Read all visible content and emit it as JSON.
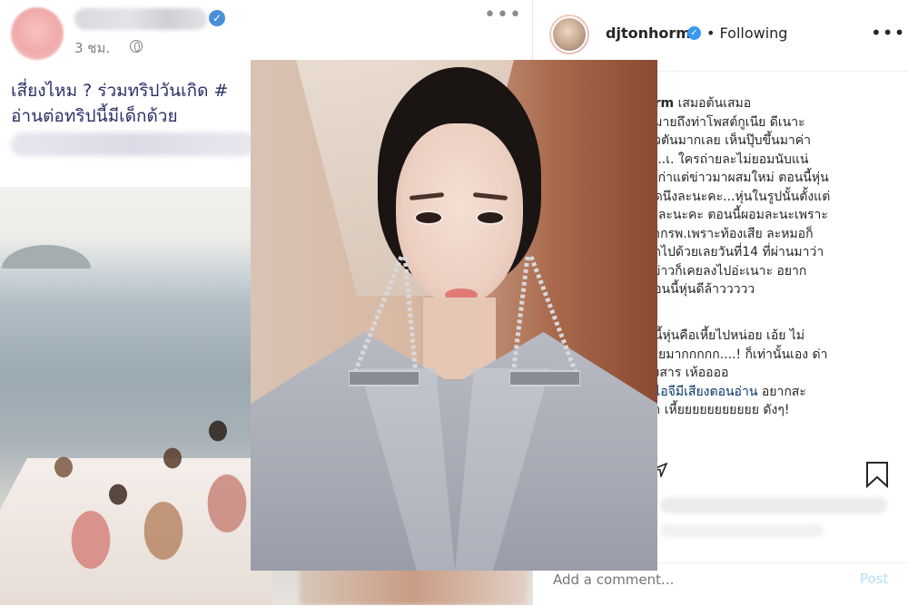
{
  "facebook_post": {
    "time": "3 ชม.",
    "text_line1": "เสี่ยงไหม ? ร่วมทริปวันเกิด #",
    "text_line2": "อ่านต่อทริปนี้มีเด็กด้วย"
  },
  "instagram_post": {
    "username": "djtonhorm",
    "following_label": "• Following",
    "caption_username": "orm",
    "caption_lines": "เสมอต้นเสมอ\nหมายถึงท่าโพสต์กูเนีย ดีเนาะ\nตัวตันมากเลย เห็นปุ๊บขึ้นมาค่า\n.....เ. ใครถ่ายละไม่ยอมนับแน่\nปเก่าแต่ข่าวมาผสมใหม่ ตอนนี้หุ่น\nนิดนึงละนะคะ...หุ่นในรูปนั้นตั้งแต่\nค.ละนะคะ ตอนนี้ผอมละนะเพราะ\nจากรพ.เพราะท้องเสีย ละหมอก็\nวีดไปด้วยเลยวันที่14 ที่ผ่านมาว่า\nงข่าวก็เคยลงไปอ่ะเนาะ อยาก\nตอนนี้หุ่นดีล้าววววว",
    "caption2_lines": "ปนี้หุ่นคือเหี้ยไปหน่อย เอ้ย ไม่\nเหี่ยมากกกกก....! ก็เท่านั้นเอง ด่า\nสงสาร เห้ออออ",
    "caption_link": "ห้ไอจีมีเสียงตอนอ่าน",
    "caption_link_tail": " อยากสะ",
    "caption_last": "อ่า เหี้ยยยยยยยยยยย ดังๆ!",
    "comment_placeholder": "Add a comment...",
    "post_label": "Post"
  },
  "colors": {
    "instagram_link": "#003569",
    "verified_badge": "#3897f0",
    "facebook_text": "#2c2f66"
  },
  "icons": [
    "verified-badge-icon",
    "globe-icon",
    "more-options-icon",
    "share-icon",
    "bookmark-icon"
  ]
}
